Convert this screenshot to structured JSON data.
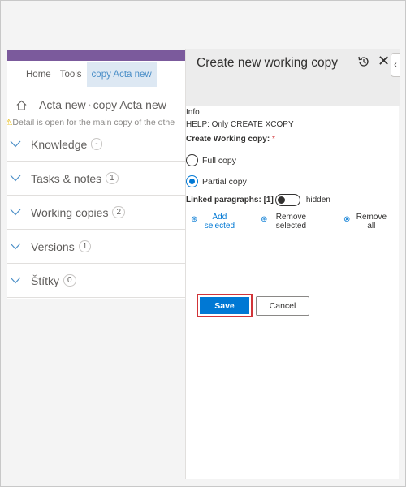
{
  "nav": {
    "home": "Home",
    "tools": "Tools",
    "active_tab": "copy Acta new"
  },
  "breadcrumb": {
    "item1": "Acta new",
    "item2": "copy Acta new"
  },
  "warning": {
    "icon": "⚠",
    "text": "Detail is open for the main copy of the othe"
  },
  "sections": [
    {
      "label": "Knowledge",
      "badge": "-"
    },
    {
      "label": "Tasks & notes",
      "badge": "1"
    },
    {
      "label": "Working copies",
      "badge": "2"
    },
    {
      "label": "Versions",
      "badge": "1"
    },
    {
      "label": "Štítky",
      "badge": "0"
    }
  ],
  "panel": {
    "title": "Create new working copy",
    "info": "Info",
    "help": "HELP: Only CREATE XCOPY",
    "create_label": "Create Working copy:",
    "required_mark": "*",
    "options": {
      "full": "Full copy",
      "partial": "Partial copy",
      "selected": "partial"
    },
    "linked_label": "Linked paragraphs: [1]",
    "toggle_state": "hidden",
    "actions": {
      "add": "Add selected",
      "remove": "Remove selected",
      "remove_all": "Remove all"
    },
    "save": "Save",
    "cancel": "Cancel"
  },
  "colors": {
    "accent": "#0078d4",
    "brand_bar": "#7b5a9c",
    "highlight_border": "#d13438"
  }
}
